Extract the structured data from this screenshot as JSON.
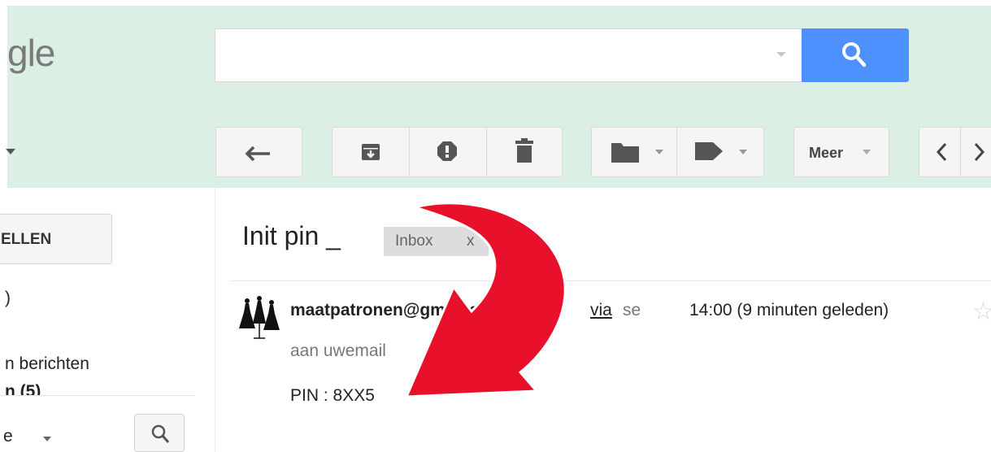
{
  "header": {
    "logo_text": "gle",
    "search": {
      "value": "",
      "placeholder": ""
    }
  },
  "toolbar": {
    "buttons": [
      {
        "name": "reply",
        "icon": "reply-arrow-icon"
      },
      {
        "name": "archive",
        "icon": "archive-icon"
      },
      {
        "name": "report-spam",
        "icon": "spam-icon"
      },
      {
        "name": "delete",
        "icon": "trash-icon"
      },
      {
        "name": "move-to",
        "icon": "folder-icon"
      },
      {
        "name": "labels",
        "icon": "label-tag-icon"
      }
    ],
    "more_label": "Meer",
    "nav": [
      "previous",
      "next"
    ]
  },
  "sidebar": {
    "compose_label": "ELLEN",
    "item_1": ")",
    "item_2": "n berichten",
    "item_3": "n (5)",
    "people_label": "e"
  },
  "message": {
    "subject": "Init pin _",
    "label_tag": "Inbox",
    "label_remove": "x",
    "sender": "maatpatronen@gmail.com",
    "via": "via",
    "via_rest": "se",
    "time": "14:00 (9 minuten geleden)",
    "to": "aan uwemail",
    "body": "PIN : 8XX5"
  },
  "annotation": {
    "arrow_color": "#e8102a"
  },
  "colors": {
    "accent": "#4d90fe",
    "header_bg": "#dcefe4"
  }
}
